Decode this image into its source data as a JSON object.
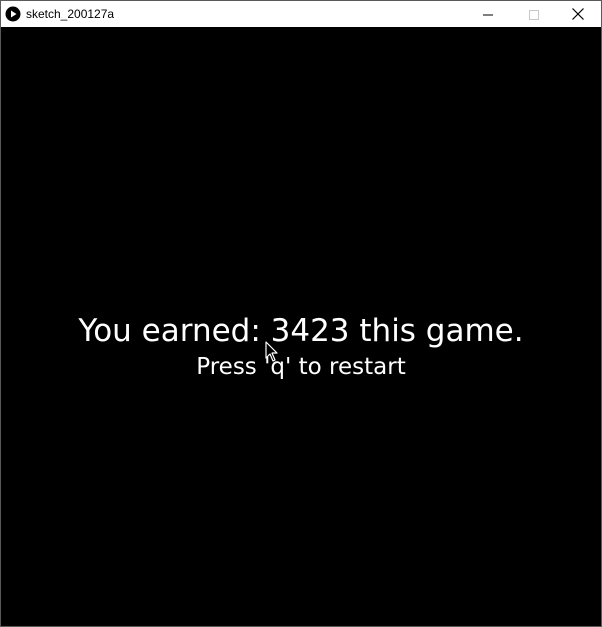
{
  "window": {
    "title": "sketch_200127a",
    "icons": {
      "app": "processing-play-icon",
      "minimize": "minimize-icon",
      "maximize": "maximize-icon",
      "close": "close-icon"
    }
  },
  "game": {
    "background_color": "#000000",
    "text_color": "#ffffff",
    "score_message": "You earned: 3423 this game.",
    "restart_message": "Press 'q' to restart"
  },
  "cursor": {
    "icon": "mouse-pointer-icon"
  }
}
